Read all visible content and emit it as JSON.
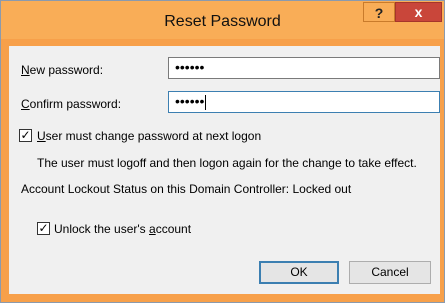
{
  "window": {
    "title": "Reset Password",
    "help_label": "?",
    "close_label": "x"
  },
  "form": {
    "new_password": {
      "label_underlined": "N",
      "label_rest": "ew password:",
      "value": "••••••"
    },
    "confirm_password": {
      "label_underlined": "C",
      "label_rest": "onfirm password:",
      "value": "••••••"
    },
    "must_change": {
      "label_underlined": "U",
      "label_rest": "ser must change password at next logon",
      "checked": "✓"
    },
    "info_text": "The user must logoff and then logon again for the change to take effect.",
    "lockout_status": "Account Lockout Status on this Domain Controller: Locked out",
    "unlock": {
      "label_prefix": "Unlock the user's ",
      "label_underlined": "a",
      "label_suffix": "ccount",
      "checked": "✓"
    }
  },
  "buttons": {
    "ok": "OK",
    "cancel": "Cancel"
  }
}
